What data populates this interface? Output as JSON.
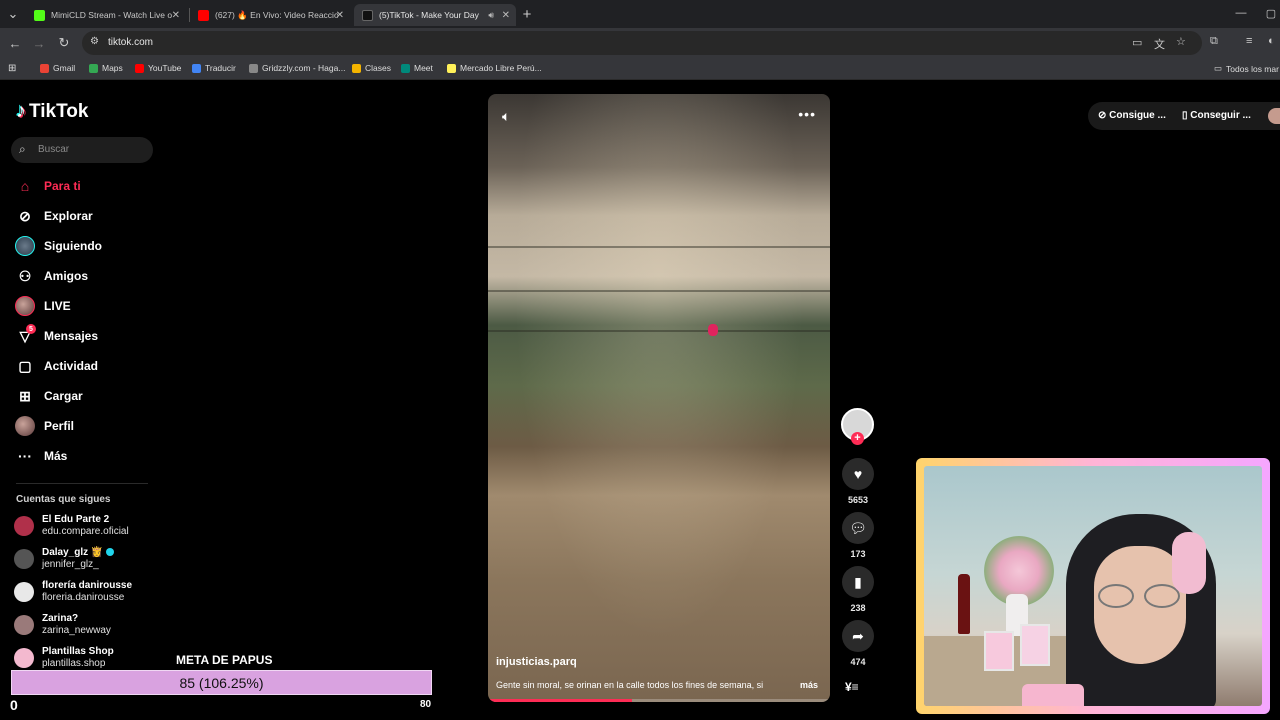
{
  "browser": {
    "tabs": [
      {
        "title": "MimiCLD Stream - Watch Live o",
        "favicon_color": "#53fc18"
      },
      {
        "title": "(627) 🔥 En Vivo: Video Reaccio",
        "favicon_color": "#ff0000"
      },
      {
        "title": "(5)TikTok - Make Your Day",
        "favicon_color": "#111111"
      }
    ],
    "url": "tiktok.com",
    "bookmarks": [
      {
        "label": "Gmail",
        "color": "#ea4335"
      },
      {
        "label": "Maps",
        "color": "#34a853"
      },
      {
        "label": "YouTube",
        "color": "#ff0000"
      },
      {
        "label": "Traducir",
        "color": "#4285f4"
      },
      {
        "label": "Gridzzly.com - Haga...",
        "color": "#888888"
      },
      {
        "label": "Clases",
        "color": "#f4b400"
      },
      {
        "label": "Meet",
        "color": "#00897b"
      },
      {
        "label": "Mercado Libre Perú...",
        "color": "#fff159"
      }
    ],
    "all_bookmarks": "Todos los mar"
  },
  "sidebar": {
    "logo": "TikTok",
    "search_placeholder": "Buscar",
    "items": [
      {
        "label": "Para ti",
        "icon": "home-icon"
      },
      {
        "label": "Explorar",
        "icon": "compass-icon"
      },
      {
        "label": "Siguiendo",
        "icon": "following-avatar-icon"
      },
      {
        "label": "Amigos",
        "icon": "friends-icon"
      },
      {
        "label": "LIVE",
        "icon": "live-icon"
      },
      {
        "label": "Mensajes",
        "icon": "messages-icon",
        "badge": "5"
      },
      {
        "label": "Actividad",
        "icon": "activity-icon"
      },
      {
        "label": "Cargar",
        "icon": "upload-icon"
      },
      {
        "label": "Perfil",
        "icon": "profile-icon"
      },
      {
        "label": "Más",
        "icon": "more-dots-icon"
      }
    ],
    "following_title": "Cuentas que sigues",
    "following": [
      {
        "name": "El Edu Parte 2 ",
        "handle": "edu.compare.oficial",
        "color": "#b0304a"
      },
      {
        "name": "Dalay_glz 👸",
        "handle": "jennifer_glz_",
        "color": "#555555",
        "verified": true
      },
      {
        "name": "florería danirousse",
        "handle": "floreria.danirousse",
        "color": "#e8e8e8"
      },
      {
        "name": "Zarina?",
        "handle": "zarina_newway",
        "color": "#9a7a7a"
      },
      {
        "name": "Plantillas Shop",
        "handle": "plantillas.shop",
        "color": "#f3b9cf"
      }
    ]
  },
  "goal": {
    "title": "META DE PAPUS",
    "progress_text": "85 (106.25%)",
    "min": "0",
    "max": "80",
    "fill_fraction": 1.0
  },
  "video": {
    "author": "injusticias.parq",
    "description": "Gente sin moral, se orinan en la calle todos los fines de semana, si",
    "more": "más",
    "progress": 0.42
  },
  "actions": {
    "likes": "5653",
    "comments": "173",
    "saves": "238",
    "shares": "474"
  },
  "top_right": {
    "coins_label": "Consigue ...",
    "app_label": "Conseguir ..."
  }
}
